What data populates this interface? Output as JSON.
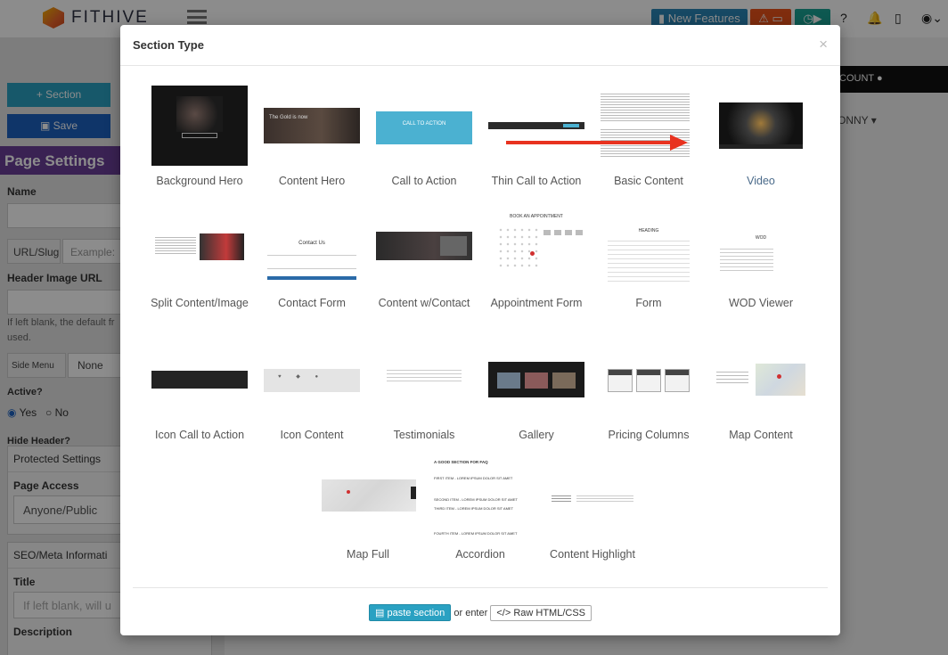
{
  "topbar": {
    "logo_text": "FITHIVE",
    "new_features_label": "New Features",
    "icons": [
      "bookmark-icon",
      "warning-icon",
      "card-icon",
      "clock-icon",
      "play-icon",
      "help-icon",
      "bell-icon",
      "phone-icon",
      "user-icon"
    ]
  },
  "sidebar": {
    "section_button": "Section",
    "save_button": "Save",
    "page_settings_title": "Page Settings",
    "name_label": "Name",
    "url_slug_label": "URL/Slug",
    "url_placeholder": "Example:",
    "header_image_label": "Header Image URL",
    "header_help": "If left blank, the default fr",
    "header_help2": "used.",
    "side_menu_label": "Side Menu",
    "side_menu_value": "None",
    "active_label": "Active?",
    "yes": "Yes",
    "no": "No",
    "hide_header_label": "Hide Header?",
    "protected_settings": "Protected Settings",
    "page_access_label": "Page Access",
    "page_access_value": "Anyone/Public",
    "seo_label": "SEO/Meta Informati",
    "title_label": "Title",
    "title_placeholder": "If left blank, will u",
    "description_label": "Description"
  },
  "main": {
    "account_label": "COUNT",
    "user_name": "ONNY"
  },
  "modal": {
    "title": "Section Type",
    "close": "×",
    "selected": "Video",
    "tiles": [
      {
        "label": "Background Hero"
      },
      {
        "label": "Content Hero"
      },
      {
        "label": "Call to Action"
      },
      {
        "label": "Thin Call to Action"
      },
      {
        "label": "Basic Content"
      },
      {
        "label": "Video"
      },
      {
        "label": "Split Content/Image"
      },
      {
        "label": "Contact Form"
      },
      {
        "label": "Content w/Contact"
      },
      {
        "label": "Appointment Form"
      },
      {
        "label": "Form"
      },
      {
        "label": "WOD Viewer"
      },
      {
        "label": "Icon Call to Action"
      },
      {
        "label": "Icon Content"
      },
      {
        "label": "Testimonials"
      },
      {
        "label": "Gallery"
      },
      {
        "label": "Pricing Columns"
      },
      {
        "label": "Map Content"
      },
      {
        "label": "Map Full"
      },
      {
        "label": "Accordion"
      },
      {
        "label": "Content Highlight"
      }
    ],
    "thumb_text": {
      "content_hero": "The Gold is now",
      "call_to_action": "CALL TO ACTION",
      "contact_form": "Contact Us",
      "appointment": "BOOK AN APPOINTMENT",
      "form_heading": "HEADING",
      "wod": "WOD",
      "accordion_title": "A GOOD SECTION FOR FAQ",
      "accordion_items": [
        "FIRST ITEM - LOREM IPSUM DOLOR SIT AMET",
        "SECOND ITEM - LOREM IPSUM DOLOR SIT AMET",
        "THIRD ITEM - LOREM IPSUM DOLOR SIT AMET",
        "FOURTH ITEM - LOREM IPSUM DOLOR SIT AMET"
      ]
    },
    "footer": {
      "paste_label": "paste section",
      "or_enter": "or enter",
      "raw_label": "Raw HTML/CSS"
    }
  },
  "colors": {
    "accent_teal": "#2aa1c2",
    "save_blue": "#1c62c0",
    "page_settings_purple": "#6a3e98",
    "arrow_red": "#e8321f"
  }
}
